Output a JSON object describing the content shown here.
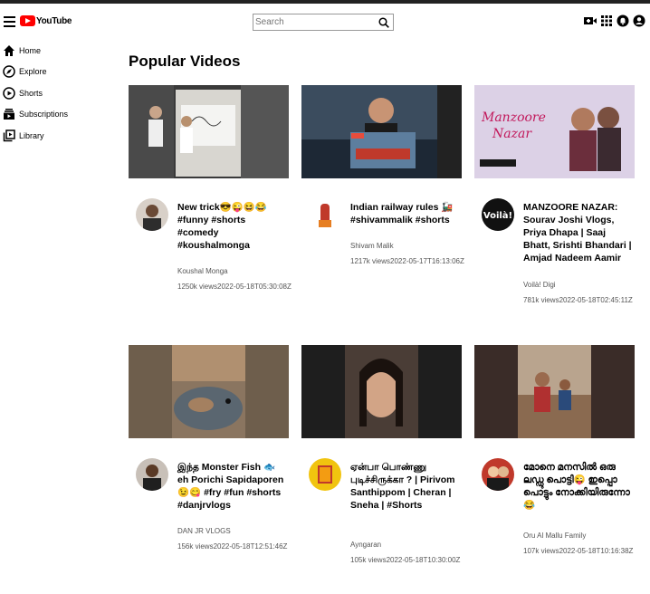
{
  "header": {
    "logo_text": "YouTube",
    "search_placeholder": "Search",
    "icons": [
      "menu-icon",
      "create-video-icon",
      "apps-grid-icon",
      "notifications-icon",
      "account-icon"
    ]
  },
  "sidebar": {
    "items": [
      {
        "label": "Home",
        "icon": "home-icon"
      },
      {
        "label": "Explore",
        "icon": "explore-icon"
      },
      {
        "label": "Shorts",
        "icon": "shorts-icon"
      },
      {
        "label": "Subscriptions",
        "icon": "subscriptions-icon"
      },
      {
        "label": "Library",
        "icon": "library-icon"
      }
    ]
  },
  "main": {
    "title": "Popular Videos",
    "videos": [
      {
        "title": "New trick😎😜😆😂 #funny #shorts #comedy #koushalmonga",
        "channel": "Koushal Monga",
        "views": "1250k views",
        "date": "2022-05-18T05:30:08Z"
      },
      {
        "title": "Indian railway rules 🚂 #shivammalik #shorts",
        "channel": "Shivam Malik",
        "views": "1217k views",
        "date": "2022-05-17T16:13:06Z"
      },
      {
        "title": "MANZOORE NAZAR: Sourav Joshi Vlogs, Priya Dhapa | Saaj Bhatt, Srishti Bhandari | Amjad Nadeem Aamir",
        "channel": "Voilà! Digi",
        "views": "781k views",
        "date": "2022-05-18T02:45:11Z"
      },
      {
        "title": "இந்த Monster Fish 🐟 eh Porichi Sapidaporen 😉😋 #fry #fun #shorts #danjrvlogs",
        "channel": "DAN JR VLOGS",
        "views": "156k views",
        "date": "2022-05-18T12:51:46Z"
      },
      {
        "title": "ஏன்பா பொண்ணு புடிச்சிருக்கா ? | Pirivom Santhippom | Cheran | Sneha | #Shorts",
        "channel": "Ayngaran",
        "views": "105k views",
        "date": "2022-05-18T10:30:00Z"
      },
      {
        "title": "മോനെ മനസിൽ ഒരു ലഡ്ഡു പൊട്ടി😜 ഇപ്പൊ പൊട്ടും നോക്കിയിരുന്നോ😂",
        "channel": "Oru Al Mallu Family",
        "views": "107k views",
        "date": "2022-05-18T10:16:38Z"
      }
    ]
  }
}
